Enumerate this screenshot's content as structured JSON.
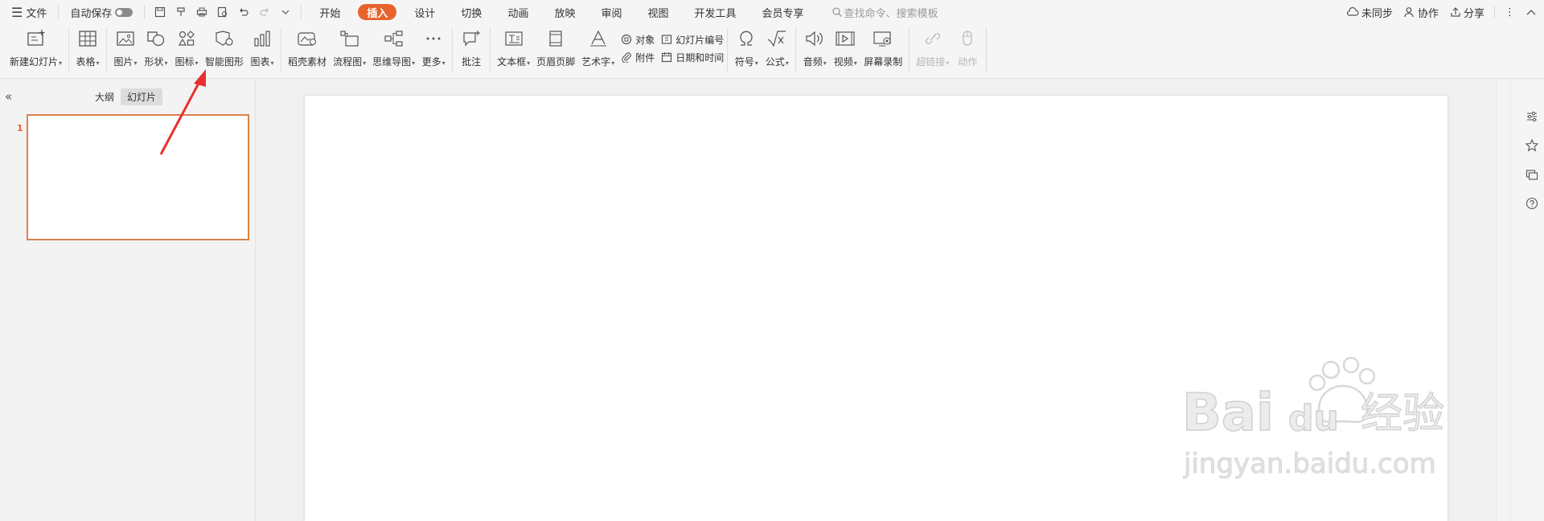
{
  "menubar": {
    "file": "文件",
    "autosave": "自动保存",
    "tabs": [
      "开始",
      "插入",
      "设计",
      "切换",
      "动画",
      "放映",
      "审阅",
      "视图",
      "开发工具",
      "会员专享"
    ],
    "active_tab": "插入",
    "search_placeholder": "查找命令、搜索模板",
    "right": {
      "sync": "未同步",
      "collab": "协作",
      "share": "分享"
    }
  },
  "ribbon": {
    "new_slide": "新建幻灯片",
    "table": "表格",
    "picture": "图片",
    "shape": "形状",
    "icon": "图标",
    "smartart": "智能图形",
    "chart": "图表",
    "material": "稻壳素材",
    "flowchart": "流程图",
    "mindmap": "思维导图",
    "more": "更多",
    "comment": "批注",
    "textbox": "文本框",
    "header_footer": "页眉页脚",
    "wordart": "艺术字",
    "object": "对象",
    "attachment": "附件",
    "slide_number": "幻灯片编号",
    "date_time": "日期和时间",
    "symbol": "符号",
    "formula": "公式",
    "audio": "音频",
    "video": "视频",
    "screen_record": "屏幕录制",
    "hyperlink": "超链接",
    "action": "动作"
  },
  "left_panel": {
    "outline_tab": "大纲",
    "slides_tab": "幻灯片",
    "slide_index": "1"
  },
  "watermark": {
    "brand": "Bai du 经验",
    "url": "jingyan.baidu.com"
  },
  "colors": {
    "accent": "#e8632c",
    "arrow": "#e8312f"
  }
}
